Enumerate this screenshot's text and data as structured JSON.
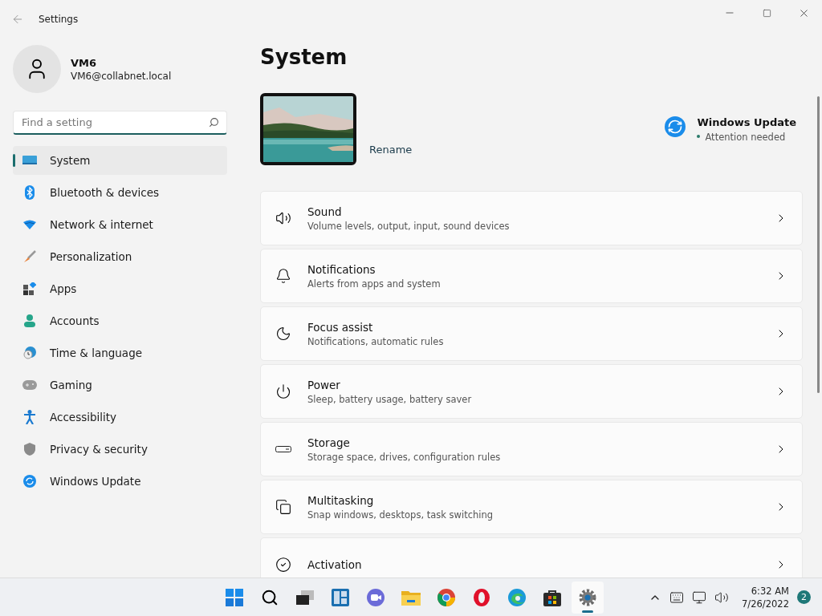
{
  "window": {
    "title": "Settings"
  },
  "account": {
    "name": "VM6",
    "email": "VM6@collabnet.local"
  },
  "search": {
    "placeholder": "Find a setting"
  },
  "sidebar": {
    "items": [
      {
        "label": "System",
        "selected": true
      },
      {
        "label": "Bluetooth & devices",
        "selected": false
      },
      {
        "label": "Network & internet",
        "selected": false
      },
      {
        "label": "Personalization",
        "selected": false
      },
      {
        "label": "Apps",
        "selected": false
      },
      {
        "label": "Accounts",
        "selected": false
      },
      {
        "label": "Time & language",
        "selected": false
      },
      {
        "label": "Gaming",
        "selected": false
      },
      {
        "label": "Accessibility",
        "selected": false
      },
      {
        "label": "Privacy & security",
        "selected": false
      },
      {
        "label": "Windows Update",
        "selected": false
      }
    ]
  },
  "page": {
    "title": "System",
    "rename": "Rename",
    "update": {
      "title": "Windows Update",
      "status": "Attention needed"
    }
  },
  "cards": [
    {
      "title": "Sound",
      "subtitle": "Volume levels, output, input, sound devices"
    },
    {
      "title": "Notifications",
      "subtitle": "Alerts from apps and system"
    },
    {
      "title": "Focus assist",
      "subtitle": "Notifications, automatic rules"
    },
    {
      "title": "Power",
      "subtitle": "Sleep, battery usage, battery saver"
    },
    {
      "title": "Storage",
      "subtitle": "Storage space, drives, configuration rules"
    },
    {
      "title": "Multitasking",
      "subtitle": "Snap windows, desktops, task switching"
    },
    {
      "title": "Activation"
    }
  ],
  "taskbar": {
    "apps": [
      {
        "selected": false
      },
      {
        "selected": false
      },
      {
        "selected": false
      },
      {
        "selected": false
      },
      {
        "selected": false
      },
      {
        "selected": false
      },
      {
        "selected": false
      },
      {
        "selected": false
      },
      {
        "selected": false
      },
      {
        "selected": false
      },
      {
        "selected": true
      }
    ],
    "time": "6:32 AM",
    "date": "7/26/2022",
    "badge": "2"
  }
}
